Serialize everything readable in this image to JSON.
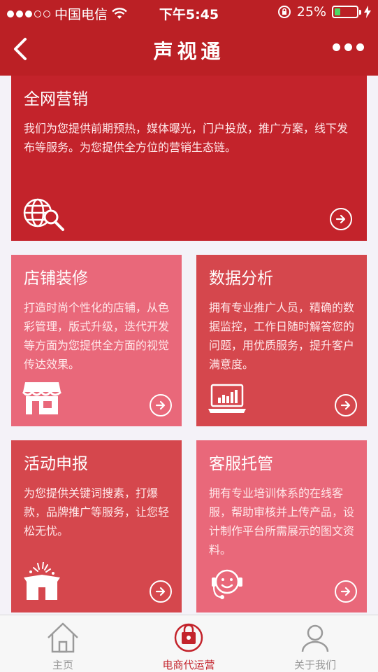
{
  "status_bar": {
    "carrier": "中国电信",
    "time": "下午5:45",
    "battery_percent": "25%",
    "battery_level": 0.25,
    "signal_dots_filled": 3,
    "signal_dots_total": 5
  },
  "header": {
    "title": "声视通",
    "back_icon": "chevron-left-icon",
    "more_icon": "more-dots-icon"
  },
  "cards": [
    {
      "title": "全网营销",
      "description": "我们为您提供前期预热，媒体曝光，门户投放，推广方案，线下发布等服务。为您提供全方位的营销生态链。",
      "icon": "globe-search-icon",
      "color": "#c3232b"
    },
    {
      "title": "店铺装修",
      "description": "打造时尚个性化的店铺，从色彩管理，版式升级，迭代开发等方面为您提供全方面的视觉传达效果。",
      "icon": "storefront-icon",
      "color": "#e9687a"
    },
    {
      "title": "数据分析",
      "description": "拥有专业推广人员，精确的数据监控，工作日随时解答您的问题，用优质服务，提升客户满意度。",
      "icon": "laptop-chart-icon",
      "color": "#d5474d"
    },
    {
      "title": "活动申报",
      "description": "为您提供关键词搜素，打爆款，品牌推广等服务，让您轻松无忧。",
      "icon": "gift-box-icon",
      "color": "#d5474d"
    },
    {
      "title": "客服托管",
      "description": "拥有专业培训体系的在线客服，帮助审核并上传产品，设计制作平台所需展示的图文资料。",
      "icon": "headset-agent-icon",
      "color": "#e9687a"
    }
  ],
  "tabbar": {
    "tabs": [
      {
        "label": "主页",
        "icon": "home-icon",
        "active": false
      },
      {
        "label": "电商代运营",
        "icon": "shop-service-icon",
        "active": true
      },
      {
        "label": "关于我们",
        "icon": "about-icon",
        "active": false
      }
    ]
  },
  "colors": {
    "header_bg": "#bb2025",
    "accent": "#c3232b",
    "pink": "#e9687a",
    "rose": "#d5474d",
    "battery_green": "#4cd964"
  }
}
